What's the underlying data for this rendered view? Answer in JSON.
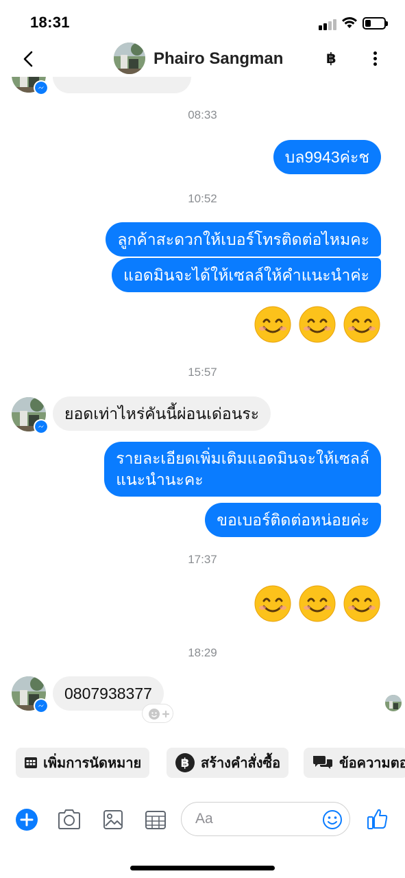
{
  "status_bar": {
    "time": "18:31"
  },
  "header": {
    "contact_name": "Phairo Sangman"
  },
  "messages": {
    "ts1": "08:33",
    "m1": "บล9943ค่ะช",
    "ts2": "10:52",
    "m2": "ลูกค้าสะดวกให้เบอร์โทรติดต่อไหมคะ",
    "m3": "แอดมินจะได้ให้เซลล์ให้คำแนะนำค่ะ",
    "ts3": "15:57",
    "m4": "ยอดเท่าไหร่คันนี้ผ่อนเด่อนระ",
    "m5_line1": "รายละเอียดเพิ่มเติมแอดมินจะให้เซลล์",
    "m5_line2": "แนะนำนะคะ",
    "m6": "ขอเบอร์ติดต่อหน่อยค่ะ",
    "ts4": "17:37",
    "ts5": "18:29",
    "m7": "0807938377"
  },
  "quick_actions": {
    "appointment": "เพิ่มการนัดหมาย",
    "create_order": "สร้างคำสั่งซื้อ",
    "saved_replies": "ข้อความตอ"
  },
  "composer": {
    "placeholder": "Aa"
  },
  "colors": {
    "accent": "#0a7cff",
    "incoming_bubble": "#f0f0f0",
    "timestamp": "#8a8d91"
  }
}
